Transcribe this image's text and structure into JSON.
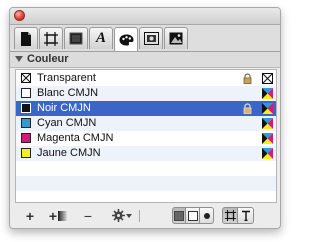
{
  "section": {
    "title": "Couleur"
  },
  "tabs": [
    {
      "icon": "document-icon"
    },
    {
      "icon": "frame-icon"
    },
    {
      "icon": "box-icon"
    },
    {
      "icon": "text-style-icon",
      "glyph": "A"
    },
    {
      "icon": "color-palette-icon",
      "active": true
    },
    {
      "icon": "picture-frame-icon"
    },
    {
      "icon": "image-icon"
    }
  ],
  "swatches": [
    {
      "name": "Transparent",
      "color": "none",
      "locked": true,
      "indicator": "none-icon"
    },
    {
      "name": "Blanc CMJN",
      "color": "#ffffff",
      "locked": false,
      "indicator": "cmyk-icon"
    },
    {
      "name": "Noir CMJN",
      "color": "#111111",
      "locked": true,
      "indicator": "cmyk-icon",
      "selected": true
    },
    {
      "name": "Cyan CMJN",
      "color": "#2e9ad6",
      "locked": false,
      "indicator": "cmyk-icon"
    },
    {
      "name": "Magenta CMJN",
      "color": "#d51a7d",
      "locked": false,
      "indicator": "cmyk-icon"
    },
    {
      "name": "Jaune CMJN",
      "color": "#f3ee1c",
      "locked": false,
      "indicator": "cmyk-icon"
    }
  ],
  "footer": {
    "add": "+",
    "remove": "−",
    "tint_mode": "solid",
    "apply_to": "frame"
  },
  "colors": {
    "selection": "#3b66c7",
    "alt_row": "#eef3fb"
  }
}
